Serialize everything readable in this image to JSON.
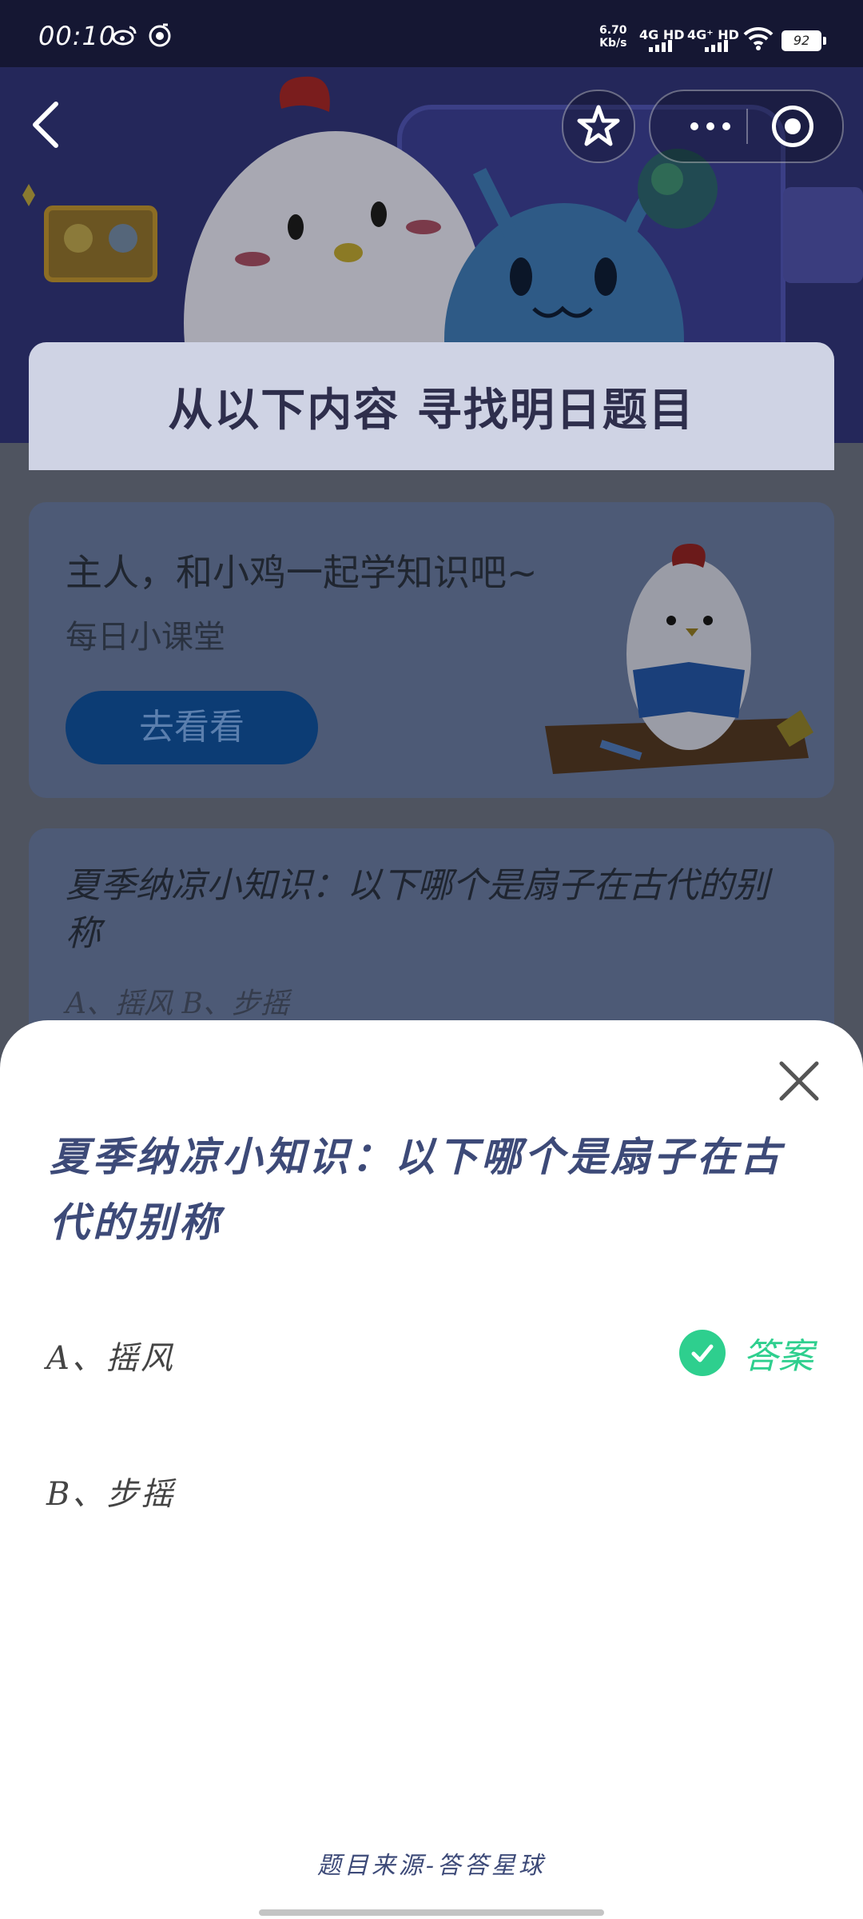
{
  "status_bar": {
    "time": "00:10",
    "net_speed": "6.70",
    "net_unit": "Kb/s",
    "sim1": "4G HD",
    "sim2": "4G⁺ HD",
    "battery": "92"
  },
  "hero": {
    "heading": "从以下内容  寻找明日题目"
  },
  "lesson_card": {
    "title": "主人，和小鸡一起学知识吧~",
    "subtitle": "每日小课堂",
    "button": "去看看"
  },
  "quiz_card": {
    "question": "夏季纳凉小知识：以下哪个是扇子在古代的别称",
    "options": "A、摇风    B、步摇"
  },
  "sheet": {
    "question": "夏季纳凉小知识：以下哪个是扇子在古代的别称",
    "option_a": "A、摇风",
    "option_b": "B、步摇",
    "answer_label": "答案",
    "source": "题目来源-答答星球"
  },
  "colors": {
    "accent_green": "#2ecf8e",
    "question_blue": "#3d4a78"
  }
}
